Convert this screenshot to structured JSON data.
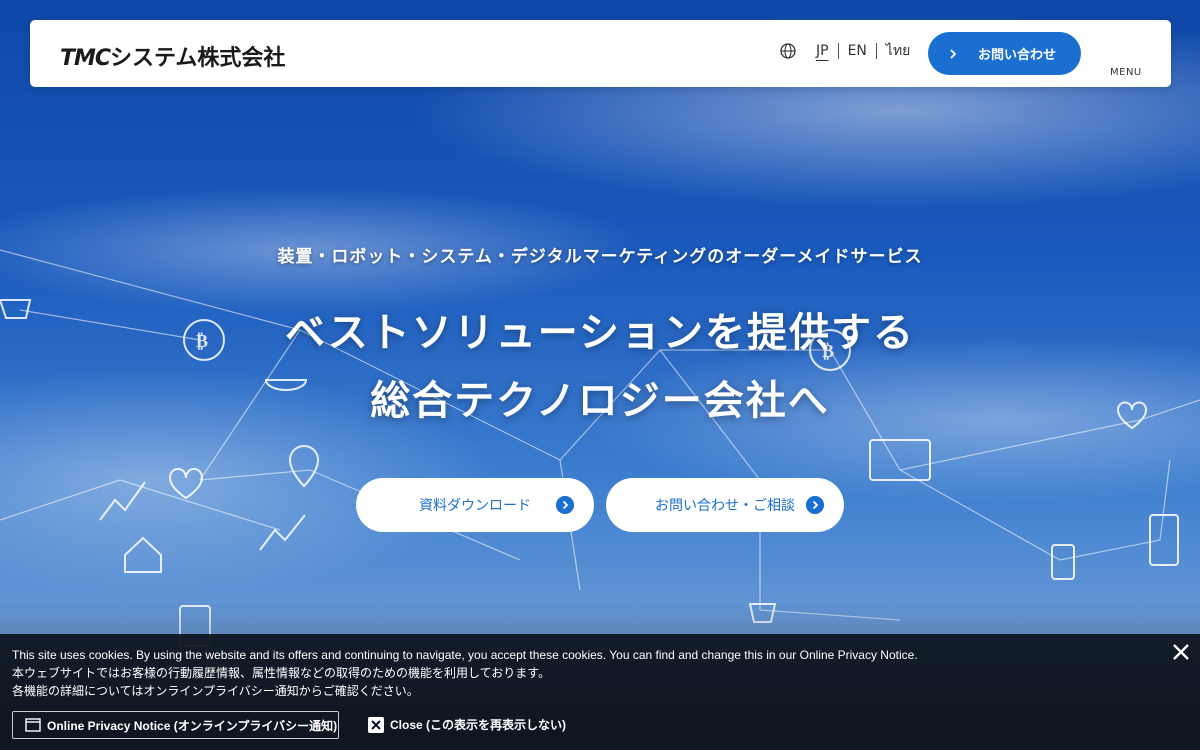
{
  "header": {
    "logo_brand": "TMC",
    "logo_rest": "システム株式会社",
    "languages": [
      {
        "label": "JP",
        "active": true
      },
      {
        "label": "EN",
        "active": false
      },
      {
        "label": "ไทย",
        "active": false
      }
    ],
    "contact_label": "お問い合わせ",
    "menu_label": "MENU"
  },
  "hero": {
    "subtitle": "装置・ロボット・システム・デジタルマーケティングのオーダーメイドサービス",
    "headline_line1": "ベストソリューションを提供する",
    "headline_line2": "総合テクノロジー会社へ",
    "cta_download": "資料ダウンロード",
    "cta_consult": "お問い合わせ・ご相談"
  },
  "cookie_banner": {
    "line1": "This site uses cookies. By using the website and its offers and continuing to navigate, you accept these cookies. You can find and change this in our Online Privacy Notice.",
    "line2": "本ウェブサイトではお客様の行動履歴情報、属性情報などの取得のための機能を利用しております。",
    "line3": "各機能の詳細についてはオンラインプライバシー通知からご確認ください。",
    "privacy_button": "Online Privacy Notice (オンラインプライバシー通知)",
    "close_button": "Close (この表示を再表示しない)"
  },
  "colors": {
    "accent": "#1a6fd0",
    "banner_bg": "#0c121c"
  },
  "icons": [
    "globe-icon",
    "chevron-right-icon",
    "menu-icon",
    "arrow-right-circle-icon",
    "window-icon",
    "close-icon"
  ]
}
